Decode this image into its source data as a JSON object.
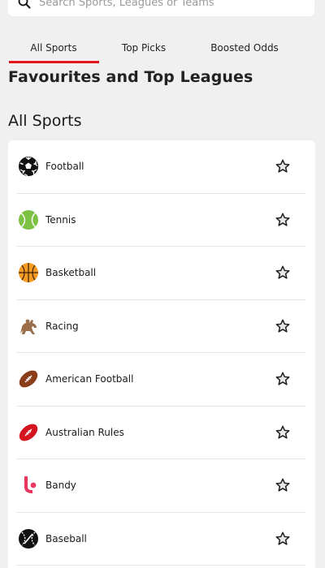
{
  "search": {
    "placeholder": "Search Sports, Leagues or Teams"
  },
  "tabs": [
    {
      "label": "All Sports",
      "active": true
    },
    {
      "label": "Top Picks",
      "active": false
    },
    {
      "label": "Boosted Odds",
      "active": false
    }
  ],
  "headings": {
    "favourites": "Favourites and Top Leagues",
    "all_sports": "All Sports"
  },
  "sports": [
    {
      "label": "Football",
      "icon": "football-icon"
    },
    {
      "label": "Tennis",
      "icon": "tennis-ball-icon"
    },
    {
      "label": "Basketball",
      "icon": "basketball-icon"
    },
    {
      "label": "Racing",
      "icon": "horse-racing-icon"
    },
    {
      "label": "American Football",
      "icon": "american-football-icon"
    },
    {
      "label": "Australian Rules",
      "icon": "australian-rules-ball-icon"
    },
    {
      "label": "Bandy",
      "icon": "bandy-icon"
    },
    {
      "label": "Baseball",
      "icon": "baseball-icon"
    }
  ],
  "colors": {
    "accent": "#e4161b",
    "background": "#f0f0f0",
    "card": "#ffffff"
  }
}
